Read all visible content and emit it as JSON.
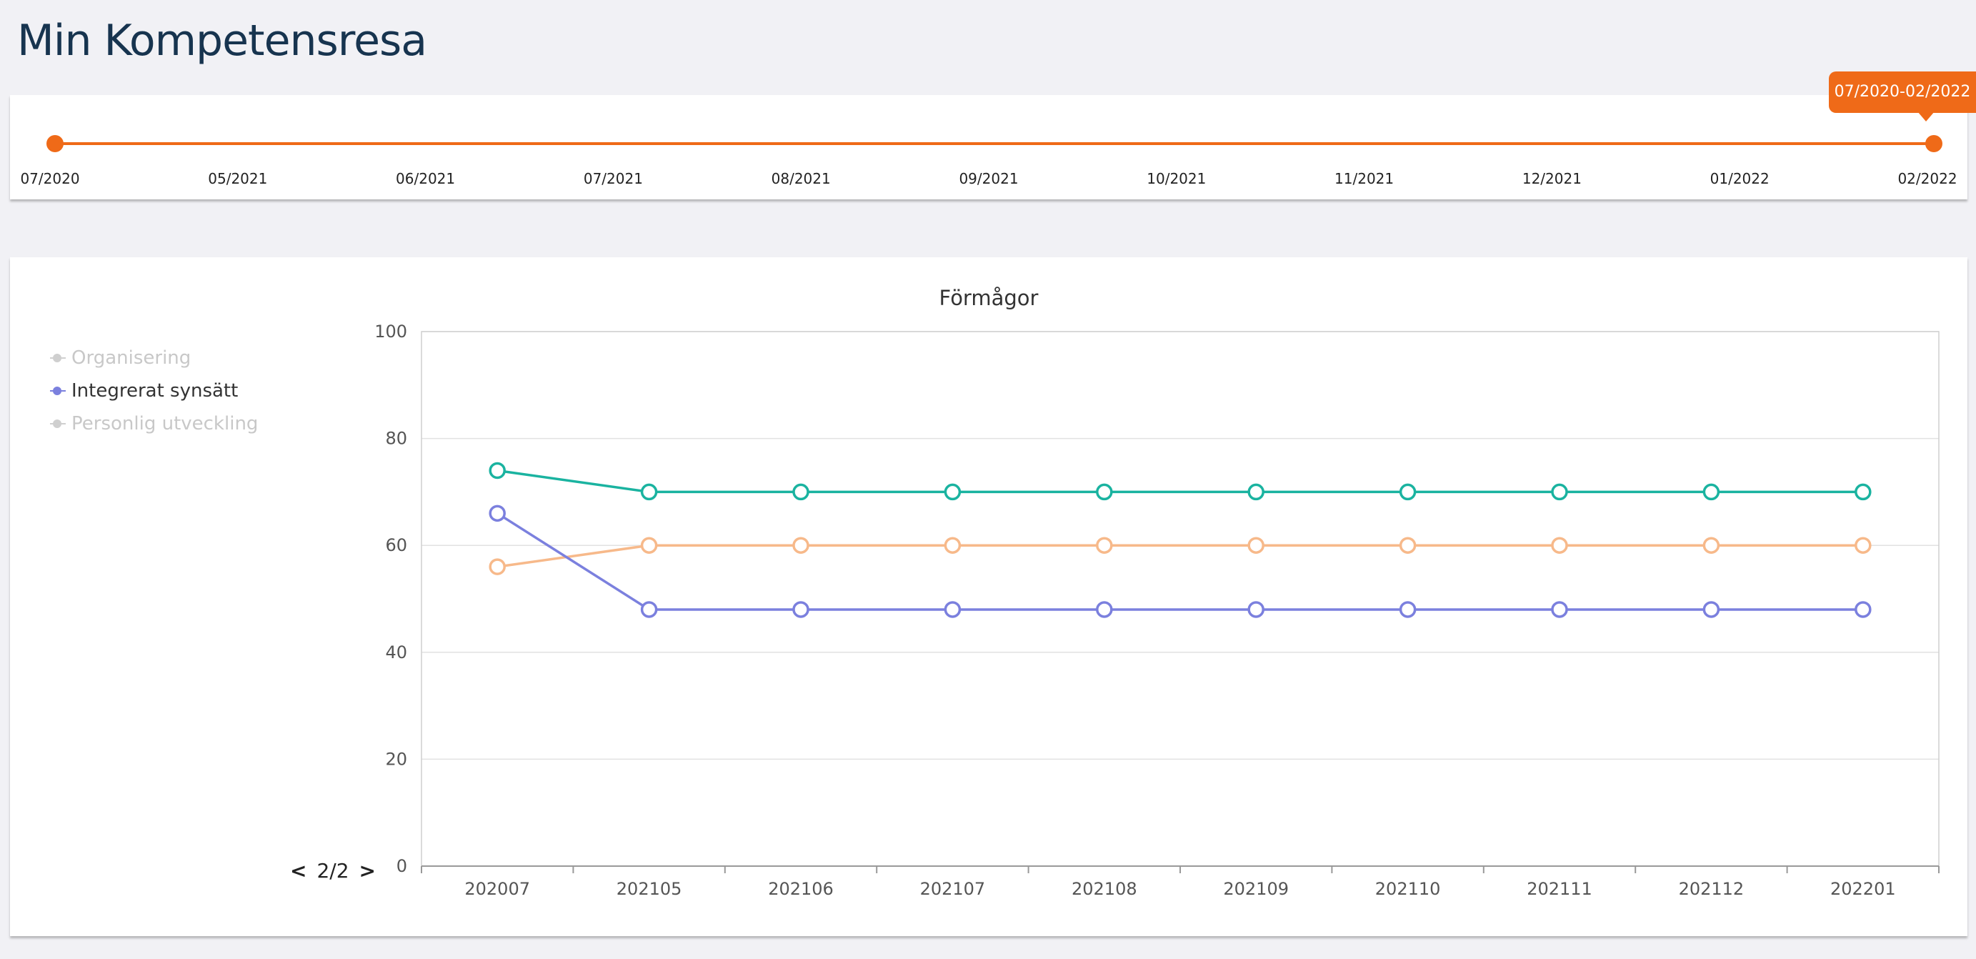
{
  "page": {
    "title": "Min Kompetensresa"
  },
  "slider": {
    "tooltip": "07/2020-02/2022",
    "ticks": [
      "07/2020",
      "05/2021",
      "06/2021",
      "07/2021",
      "08/2021",
      "09/2021",
      "10/2021",
      "11/2021",
      "12/2021",
      "01/2022",
      "02/2022"
    ],
    "accent_color": "#ef6a18"
  },
  "legend": {
    "items": [
      {
        "label": "Organisering",
        "active": false
      },
      {
        "label": "Integrerat synsätt",
        "active": true
      },
      {
        "label": "Personlig utveckling",
        "active": false
      }
    ],
    "pager": {
      "prev_icon": "chevron-left-icon",
      "text": "2/2",
      "next_icon": "chevron-right-icon"
    }
  },
  "chart_data": {
    "type": "line",
    "title": "Förmågor",
    "categories": [
      "202007",
      "202105",
      "202106",
      "202107",
      "202108",
      "202109",
      "202110",
      "202111",
      "202112",
      "202201"
    ],
    "ylim": [
      0,
      100
    ],
    "yticks": [
      0,
      20,
      40,
      60,
      80,
      100
    ],
    "grid": true,
    "series": [
      {
        "values": [
          74,
          70,
          70,
          70,
          70,
          70,
          70,
          70,
          70,
          70
        ],
        "color": "#1ab3a0"
      },
      {
        "values": [
          56,
          60,
          60,
          60,
          60,
          60,
          60,
          60,
          60,
          60
        ],
        "color": "#f7b98a"
      },
      {
        "name": "Integrerat synsätt",
        "values": [
          66,
          48,
          48,
          48,
          48,
          48,
          48,
          48,
          48,
          48
        ],
        "color": "#7b80de"
      }
    ],
    "legend_placement": "left"
  }
}
